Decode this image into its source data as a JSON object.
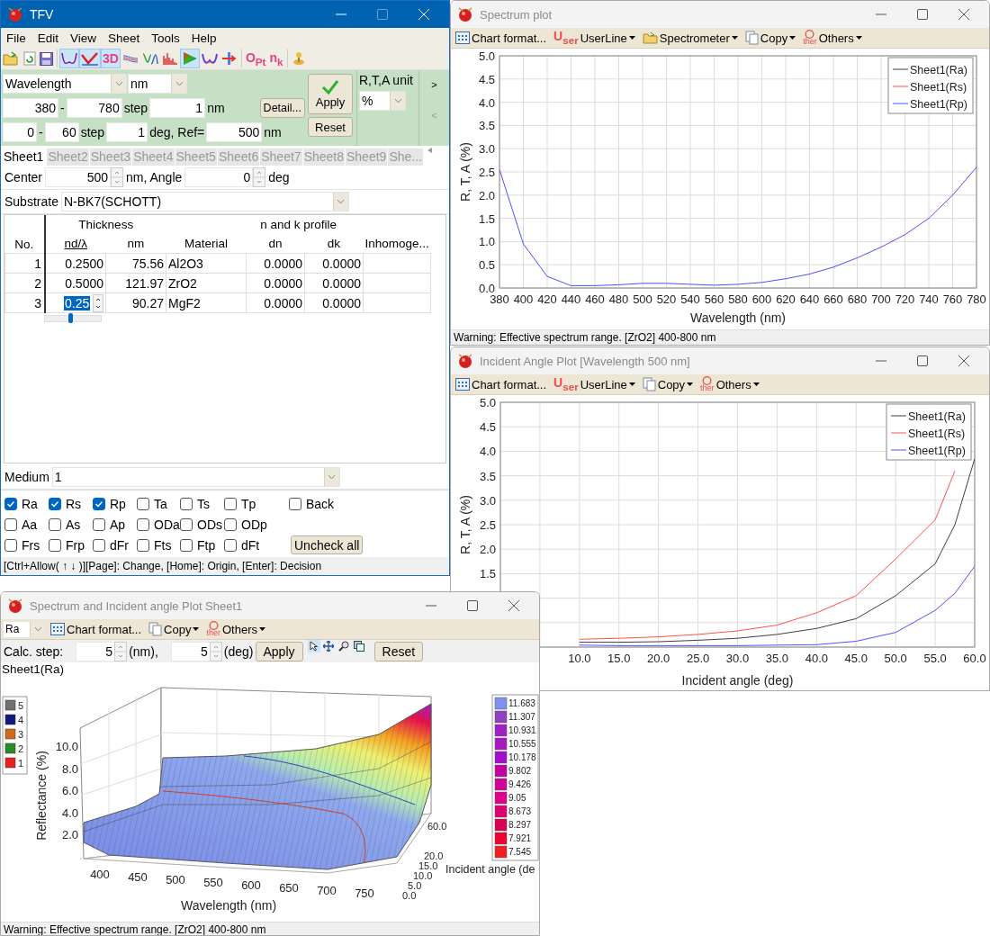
{
  "tfv": {
    "title": "TFV",
    "menu": [
      "File",
      "Edit",
      "View",
      "Sheet",
      "Tools",
      "Help"
    ],
    "toolbar": [
      {
        "kind": "open",
        "selected": false
      },
      {
        "kind": "refresh",
        "selected": false
      },
      {
        "kind": "save",
        "selected": false
      },
      {
        "kind": "sep"
      },
      {
        "kind": "wave",
        "selected": true
      },
      {
        "kind": "check",
        "selected": true
      },
      {
        "kind": "text",
        "label": "3D",
        "selected": true
      },
      {
        "kind": "lines",
        "selected": false
      },
      {
        "kind": "peak",
        "selected": false
      },
      {
        "kind": "bars",
        "selected": false
      },
      {
        "kind": "triangle",
        "selected": true
      },
      {
        "kind": "wave2",
        "selected": false
      },
      {
        "kind": "arrow",
        "selected": false
      },
      {
        "kind": "sep"
      },
      {
        "kind": "text",
        "label": "O$_{Pt}$",
        "selected": false
      },
      {
        "kind": "text",
        "label": "n$_{k}$",
        "selected": false
      },
      {
        "kind": "sep"
      },
      {
        "kind": "joystick",
        "selected": false
      }
    ],
    "range": {
      "axis_select": "Wavelength",
      "unit_select": "nm",
      "wavelength_row": {
        "from": "380",
        "dash": "-",
        "to": "780",
        "step_label": "step",
        "step": "1",
        "unit": "nm"
      },
      "detail_button": "Detail...",
      "angle_row": {
        "from": "0",
        "dash": "-",
        "to": "60",
        "step_label": "step",
        "step": "1",
        "unit": "deg, Ref=",
        "ref": "500",
        "ref_unit": "nm"
      },
      "apply_button": "Apply",
      "reset_button": "Reset",
      "unit_box": {
        "title": "R,T,A unit",
        "select": "%"
      },
      "next_arrow": ">",
      "prev_arrow": "<"
    },
    "tabs": [
      {
        "label": "Sheet1",
        "selected": true
      },
      {
        "label": "Sheet2",
        "selected": false
      },
      {
        "label": "Sheet3",
        "selected": false
      },
      {
        "label": "Sheet4",
        "selected": false
      },
      {
        "label": "Sheet5",
        "selected": false
      },
      {
        "label": "Sheet6",
        "selected": false
      },
      {
        "label": "Sheet7",
        "selected": false
      },
      {
        "label": "Sheet8",
        "selected": false
      },
      {
        "label": "Sheet9",
        "selected": false
      },
      {
        "label": "She...",
        "selected": false
      }
    ],
    "center_row": {
      "center_label": "Center",
      "center": "500",
      "angle_label": "nm, Angle",
      "angle": "0",
      "deg_label": "deg"
    },
    "substrate": {
      "label": "Substrate",
      "value": "N-BK7(SCHOTT)"
    },
    "layers": {
      "group_headers": [
        "Thickness",
        "n and k profile"
      ],
      "columns": [
        "No.",
        "nd/λ",
        "nm",
        "Material",
        "dn",
        "dk",
        "Inhomoge..."
      ],
      "rows": [
        {
          "no": "1",
          "ndl": "0.2500",
          "nm": "75.56",
          "material": "Al2O3",
          "dn": "0.0000",
          "dk": "0.0000",
          "editing": false
        },
        {
          "no": "2",
          "ndl": "0.5000",
          "nm": "121.97",
          "material": "ZrO2",
          "dn": "0.0000",
          "dk": "0.0000",
          "editing": false
        },
        {
          "no": "3",
          "ndl": "0.25",
          "nm": "90.27",
          "material": "MgF2",
          "dn": "0.0000",
          "dk": "0.0000",
          "editing": true
        }
      ],
      "editor_slider": {
        "level": 0.45
      }
    },
    "medium": {
      "label": "Medium",
      "value": "1"
    },
    "check_rows": [
      [
        {
          "label": "Ra",
          "checked": true
        },
        {
          "label": "Rs",
          "checked": true
        },
        {
          "label": "Rp",
          "checked": true
        },
        {
          "label": "Ta",
          "checked": false
        },
        {
          "label": "Ts",
          "checked": false
        },
        {
          "label": "Tp",
          "checked": false
        },
        {
          "label": "Back",
          "checked": false
        }
      ],
      [
        {
          "label": "Aa",
          "checked": false
        },
        {
          "label": "As",
          "checked": false
        },
        {
          "label": "Ap",
          "checked": false
        },
        {
          "label": "ODa",
          "checked": false
        },
        {
          "label": "ODs",
          "checked": false
        },
        {
          "label": "ODp",
          "checked": false
        }
      ],
      [
        {
          "label": "Frs",
          "checked": false
        },
        {
          "label": "Frp",
          "checked": false
        },
        {
          "label": "dFr",
          "checked": false
        },
        {
          "label": "Fts",
          "checked": false
        },
        {
          "label": "Ftp",
          "checked": false
        },
        {
          "label": "dFt",
          "checked": false
        }
      ]
    ],
    "uncheck_button": "Uncheck all",
    "status": "[Ctrl+Allow( ↑ ↓ )][Page]: Change, [Home]: Origin, [Enter]: Decision"
  },
  "spectrum_window": {
    "title": "Spectrum plot",
    "toolbar": [
      {
        "kind": "grid",
        "label": "Chart format...",
        "menu": false
      },
      {
        "kind": "user",
        "glyph": "U",
        "glyph_sub": "ser",
        "label": "UserLine",
        "menu": true
      },
      {
        "kind": "folder",
        "label": "Spectrometer",
        "menu": true
      },
      {
        "kind": "copy",
        "label": "Copy",
        "menu": true
      },
      {
        "kind": "other",
        "glyph_sub": "ther",
        "label": "Others",
        "menu": true
      }
    ],
    "chart_data": {
      "type": "line",
      "grid": true,
      "legend": "upper right",
      "xlabel": "Wavelength (nm)",
      "ylabel": "R, T, A (%)",
      "x": [
        380,
        400,
        420,
        440,
        460,
        480,
        500,
        520,
        540,
        560,
        580,
        600,
        620,
        640,
        660,
        680,
        700,
        720,
        740,
        760,
        780
      ],
      "xlim": [
        380,
        780
      ],
      "ylim": [
        0,
        5
      ],
      "xticks": [
        380,
        400,
        420,
        440,
        460,
        480,
        500,
        520,
        540,
        560,
        580,
        600,
        620,
        640,
        660,
        680,
        700,
        720,
        740,
        760,
        780
      ],
      "yticks": [
        {
          "value": 0,
          "label": "0.0"
        },
        {
          "value": 0.5,
          "label": "0.5"
        },
        {
          "value": 1,
          "label": "1.0"
        },
        {
          "value": 1.5,
          "label": "1.5"
        },
        {
          "value": 2,
          "label": "2.0"
        },
        {
          "value": 2.5,
          "label": "2.5"
        },
        {
          "value": 3,
          "label": "3.0"
        },
        {
          "value": 3.5,
          "label": "3.5"
        },
        {
          "value": 4,
          "label": "4.0"
        },
        {
          "value": 4.5,
          "label": "4.5"
        },
        {
          "value": 5,
          "label": "5.0"
        }
      ],
      "series": [
        {
          "name": "Sheet1(Ra)",
          "color": "#404040",
          "values": [
            null,
            null,
            null,
            null,
            null,
            null,
            null,
            null,
            null,
            null,
            null,
            null,
            null,
            null,
            null,
            null,
            null,
            null,
            null,
            null,
            null
          ]
        },
        {
          "name": "Sheet1(Rs)",
          "color": "#ff5050",
          "values": [
            null,
            null,
            null,
            null,
            null,
            null,
            null,
            null,
            null,
            null,
            null,
            null,
            null,
            null,
            null,
            null,
            null,
            null,
            null,
            null,
            null
          ]
        },
        {
          "name": "Sheet1(Rp)",
          "color": "#5050ff",
          "values": [
            2.55,
            0.95,
            0.25,
            0.05,
            0.05,
            0.07,
            0.1,
            0.1,
            0.08,
            0.06,
            0.08,
            0.12,
            0.2,
            0.3,
            0.45,
            0.65,
            0.88,
            1.15,
            1.5,
            2.0,
            2.6
          ]
        }
      ]
    },
    "status": "Warning: Effective spectrum range. [ZrO2] 400-800 nm"
  },
  "incident_window": {
    "title": "Incident Angle Plot [Wavelength 500 nm]",
    "toolbar": [
      {
        "kind": "grid",
        "label": "Chart format...",
        "menu": false
      },
      {
        "kind": "user",
        "glyph": "U",
        "glyph_sub": "ser",
        "label": "UserLine",
        "menu": true
      },
      {
        "kind": "copy",
        "label": "Copy",
        "menu": true
      },
      {
        "kind": "other",
        "glyph_sub": "ther",
        "label": "Others",
        "menu": true
      }
    ],
    "chart_data": {
      "type": "line",
      "grid": true,
      "legend": "upper right",
      "xlabel": "Incident angle (deg)",
      "ylabel": "R, T, A (%)",
      "x": [
        10,
        15,
        20,
        25,
        30,
        35,
        40,
        45,
        50,
        55,
        57.5,
        60
      ],
      "xlim": [
        0,
        60
      ],
      "ylim": [
        0,
        5
      ],
      "xticks": [
        {
          "value": 10,
          "label": "10.0"
        },
        {
          "value": 15,
          "label": "15.0"
        },
        {
          "value": 20,
          "label": "20.0"
        },
        {
          "value": 25,
          "label": "25.0"
        },
        {
          "value": 30,
          "label": "30.0"
        },
        {
          "value": 35,
          "label": "35.0"
        },
        {
          "value": 40,
          "label": "40.0"
        },
        {
          "value": 45,
          "label": "45.0"
        },
        {
          "value": 50,
          "label": "50.0"
        },
        {
          "value": 55,
          "label": "55.0"
        },
        {
          "value": 60,
          "label": "60.0"
        }
      ],
      "yticks": [
        {
          "value": 1.5,
          "label": "1.5"
        },
        {
          "value": 2,
          "label": "2.0"
        },
        {
          "value": 2.5,
          "label": "2.5"
        },
        {
          "value": 3,
          "label": "3.0"
        },
        {
          "value": 3.5,
          "label": "3.5"
        },
        {
          "value": 4,
          "label": "4.0"
        },
        {
          "value": 4.5,
          "label": "4.5"
        },
        {
          "value": 5,
          "label": "5.0"
        }
      ],
      "series": [
        {
          "name": "Sheet1(Ra)",
          "color": "#404040",
          "values": [
            0.1,
            0.1,
            0.11,
            0.14,
            0.18,
            0.26,
            0.38,
            0.58,
            1.05,
            1.7,
            2.5,
            3.85
          ]
        },
        {
          "name": "Sheet1(Rs)",
          "color": "#ff5050",
          "values": [
            0.16,
            0.18,
            0.21,
            0.26,
            0.33,
            0.45,
            0.7,
            1.05,
            1.8,
            2.6,
            3.6,
            null
          ]
        },
        {
          "name": "Sheet1(Rp)",
          "color": "#5050ff",
          "values": [
            0.04,
            0.03,
            0.03,
            0.03,
            0.03,
            0.04,
            0.05,
            0.12,
            0.3,
            0.75,
            1.1,
            1.65
          ]
        }
      ]
    }
  },
  "surface_window": {
    "title": "Spectrum and Incident angle Plot Sheet1",
    "mode_select": "Ra",
    "toolbar": [
      {
        "kind": "grid",
        "label": "Chart format...",
        "menu": false
      },
      {
        "kind": "copy",
        "label": "Copy",
        "menu": true
      },
      {
        "kind": "other",
        "glyph_sub": "ther",
        "label": "Others",
        "menu": true
      }
    ],
    "calc": {
      "label": "Calc. step:",
      "nm_step": "5",
      "nm_unit": "(nm),",
      "deg_step": "5",
      "deg_unit": "(deg)",
      "apply": "Apply",
      "reset": "Reset"
    },
    "tools": [
      {
        "kind": "pointer",
        "selected": true
      },
      {
        "kind": "move",
        "selected": false
      },
      {
        "kind": "zoom",
        "selected": false
      },
      {
        "kind": "copy",
        "selected": false
      }
    ],
    "plot_title": "Sheet1(Ra)",
    "level_legend": [
      {
        "label": "5",
        "color": "#707070"
      },
      {
        "label": "4",
        "color": "#101880"
      },
      {
        "label": "3",
        "color": "#d06a1a"
      },
      {
        "label": "2",
        "color": "#2a8a2a"
      },
      {
        "label": "1",
        "color": "#e82020"
      }
    ],
    "z_label": "Reflectance (%)",
    "z_ticks": [
      "10.0",
      "8.0",
      "6.0",
      "4.0",
      "2.0"
    ],
    "x_label": "Wavelength (nm)",
    "x_ticks": [
      "400",
      "450",
      "500",
      "550",
      "600",
      "650",
      "700",
      "750"
    ],
    "y_label": "Incident angle (de",
    "y_ticks": [
      "60.0",
      "20.0",
      "15.0",
      "10.0",
      "5.0",
      "0.0"
    ],
    "color_scale": [
      {
        "label": "11.683",
        "color": "#8090f0"
      },
      {
        "label": "11.307",
        "color": "#9040c0"
      },
      {
        "label": "10.931",
        "color": "#a020c8"
      },
      {
        "label": "10.555",
        "color": "#a818c0"
      },
      {
        "label": "10.178",
        "color": "#a010c8"
      },
      {
        "label": "9.802",
        "color": "#c000a0"
      },
      {
        "label": "9.426",
        "color": "#d0009a"
      },
      {
        "label": "9.05",
        "color": "#e0008a"
      },
      {
        "label": "8.673",
        "color": "#e00070"
      },
      {
        "label": "8.297",
        "color": "#d80050"
      },
      {
        "label": "7.921",
        "color": "#f00030"
      },
      {
        "label": "7.545",
        "color": "#f02020"
      }
    ],
    "status": "Warning: Effective spectrum range. [ZrO2] 400-800 nm"
  }
}
